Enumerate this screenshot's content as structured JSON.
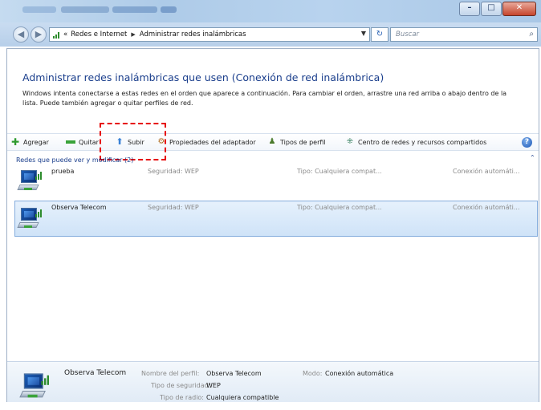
{
  "address_bar": {
    "breadcrumbs": [
      "«",
      "Redes e Internet",
      "Administrar redes inalámbricas"
    ],
    "search_placeholder": "Buscar"
  },
  "page": {
    "title": "Administrar redes inalámbricas que usen (Conexión de red inalámbrica)",
    "description": "Windows intenta conectarse a estas redes en el orden que aparece a continuación. Para cambiar el orden, arrastre una red arriba o abajo dentro de la lista. Puede también agregar o quitar perfiles de red."
  },
  "toolbar": {
    "items": [
      {
        "label": "Agregar",
        "icon": "add-icon"
      },
      {
        "label": "Quitar",
        "icon": "remove-icon"
      },
      {
        "label": "Subir",
        "icon": "move-up-icon"
      },
      {
        "label": "Propiedades del adaptador",
        "icon": "adapter-icon"
      },
      {
        "label": "Tipos de perfil",
        "icon": "user-icon"
      },
      {
        "label": "Centro de redes y recursos compartidos",
        "icon": "network-center-icon"
      }
    ],
    "help_icon": "help-icon"
  },
  "list": {
    "group_header": "Redes que puede ver y modificar (2)",
    "networks": [
      {
        "name": "prueba",
        "security": "Seguridad: WEP",
        "type": "Tipo: Cualquiera compat...",
        "connection": "Conexión automáti...",
        "selected": false
      },
      {
        "name": "Observa Telecom",
        "security": "Seguridad: WEP",
        "type": "Tipo: Cualquiera compat...",
        "connection": "Conexión automáti...",
        "selected": true
      }
    ]
  },
  "details": {
    "name": "Observa Telecom",
    "profile_label": "Nombre del perfil:",
    "profile_value": "Observa Telecom",
    "security_label": "Tipo de seguridad:",
    "security_value": "WEP",
    "radio_label": "Tipo de radio:",
    "radio_value": "Cualquiera compatible",
    "mode_label": "Modo:",
    "mode_value": "Conexión automática"
  },
  "colors": {
    "heading": "#1a3e8c",
    "annotation": "#e60000",
    "selection": "#cfe3f8"
  }
}
